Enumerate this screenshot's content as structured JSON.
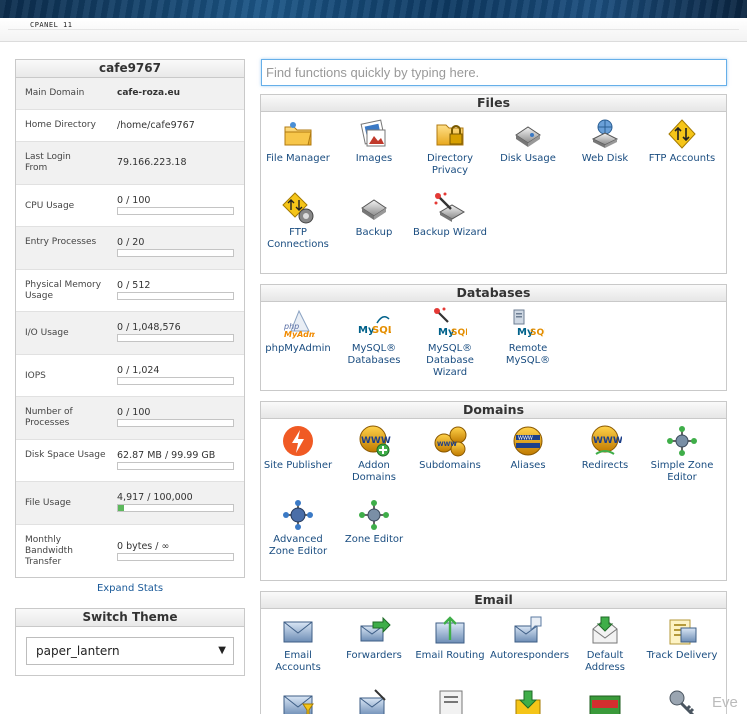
{
  "header": {
    "brand": "CPANEL 11"
  },
  "stats": {
    "title": "cafe9767",
    "rows": [
      {
        "label": "Main Domain",
        "value": "cafe-roza.eu"
      },
      {
        "label": "Home Directory",
        "value": "/home/cafe9767"
      },
      {
        "label": "Last Login From",
        "value": "79.166.223.18"
      },
      {
        "label": "CPU Usage",
        "value": "0 / 100",
        "percent": 0
      },
      {
        "label": "Entry Processes",
        "value": "0 / 20",
        "percent": 0
      },
      {
        "label": "Physical Memory Usage",
        "value": "0 / 512",
        "percent": 0
      },
      {
        "label": "I/O Usage",
        "value": "0 / 1,048,576",
        "percent": 0
      },
      {
        "label": "IOPS",
        "value": "0 / 1,024",
        "percent": 0
      },
      {
        "label": "Number of Processes",
        "value": "0 / 100",
        "percent": 0
      },
      {
        "label": "Disk Space Usage",
        "value": "62.87 MB / 99.99 GB",
        "percent": 0.06
      },
      {
        "label": "File Usage",
        "value": "4,917 / 100,000",
        "percent": 4.9
      },
      {
        "label": "Monthly Bandwidth Transfer",
        "value": "0 bytes / ∞",
        "percent": 0
      }
    ],
    "expand_label": "Expand Stats"
  },
  "theme": {
    "title": "Switch Theme",
    "selected": "paper_lantern",
    "arrow": "▼"
  },
  "search": {
    "placeholder": "Find functions quickly by typing here."
  },
  "sections": {
    "files": {
      "title": "Files",
      "items": [
        {
          "label": "File Manager",
          "icon": "folder-icon"
        },
        {
          "label": "Images",
          "icon": "images-icon"
        },
        {
          "label": "Directory Privacy",
          "icon": "folder-lock-icon"
        },
        {
          "label": "Disk Usage",
          "icon": "disk-icon"
        },
        {
          "label": "Web Disk",
          "icon": "web-disk-icon"
        },
        {
          "label": "FTP Accounts",
          "icon": "ftp-icon"
        },
        {
          "label": "FTP Connections",
          "icon": "ftp-connections-icon"
        },
        {
          "label": "Backup",
          "icon": "backup-icon"
        },
        {
          "label": "Backup Wizard",
          "icon": "backup-wizard-icon"
        }
      ]
    },
    "databases": {
      "title": "Databases",
      "items": [
        {
          "label": "phpMyAdmin",
          "icon": "phpmyadmin-icon"
        },
        {
          "label": "MySQL® Databases",
          "icon": "mysql-icon"
        },
        {
          "label": "MySQL® Database Wizard",
          "icon": "mysql-wizard-icon"
        },
        {
          "label": "Remote MySQL®",
          "icon": "remote-mysql-icon"
        }
      ]
    },
    "domains": {
      "title": "Domains",
      "items": [
        {
          "label": "Site Publisher",
          "icon": "site-publisher-icon"
        },
        {
          "label": "Addon Domains",
          "icon": "addon-domains-icon"
        },
        {
          "label": "Subdomains",
          "icon": "subdomains-icon"
        },
        {
          "label": "Aliases",
          "icon": "aliases-icon"
        },
        {
          "label": "Redirects",
          "icon": "redirects-icon"
        },
        {
          "label": "Simple Zone Editor",
          "icon": "simple-zone-editor-icon"
        },
        {
          "label": "Advanced Zone Editor",
          "icon": "advanced-zone-editor-icon"
        },
        {
          "label": "Zone Editor",
          "icon": "zone-editor-icon"
        }
      ]
    },
    "email": {
      "title": "Email",
      "items": [
        {
          "label": "Email Accounts",
          "icon": "email-accounts-icon"
        },
        {
          "label": "Forwarders",
          "icon": "forwarders-icon"
        },
        {
          "label": "Email Routing",
          "icon": "email-routing-icon"
        },
        {
          "label": "Autoresponders",
          "icon": "autoresponders-icon"
        },
        {
          "label": "Default Address",
          "icon": "default-address-icon"
        },
        {
          "label": "Track Delivery",
          "icon": "track-delivery-icon"
        }
      ]
    }
  },
  "corner_text": "Eve",
  "colors": {
    "link": "#1a4d80",
    "progress": "#5cb85c",
    "banner": "#1c5687"
  }
}
